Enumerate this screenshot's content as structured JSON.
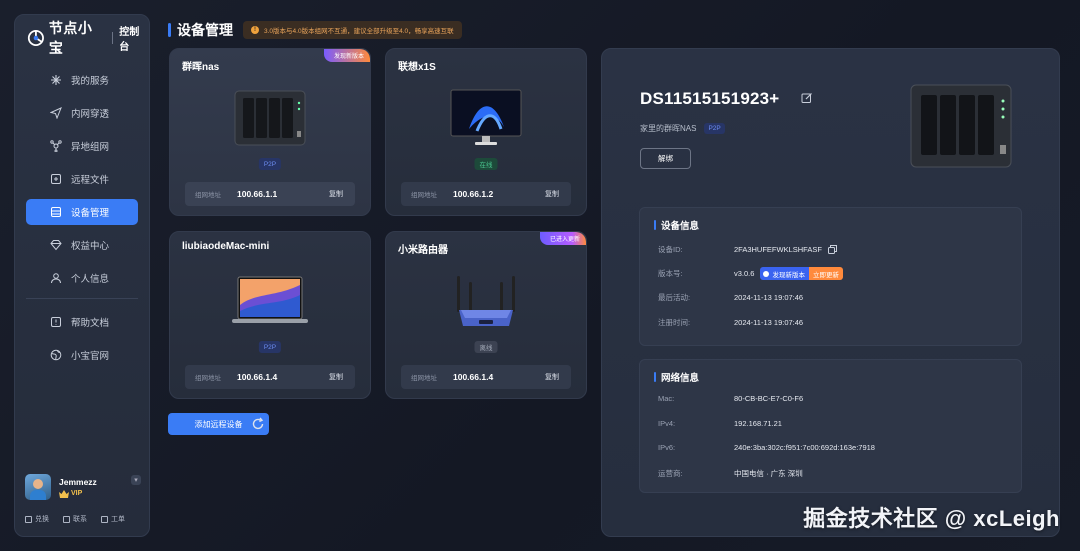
{
  "brand": {
    "name": "节点小宝",
    "sub": "控制台"
  },
  "sidebar": {
    "items": [
      {
        "label": "我的服务",
        "icon": "services-icon"
      },
      {
        "label": "内网穿透",
        "icon": "send-icon"
      },
      {
        "label": "异地组网",
        "icon": "network-icon"
      },
      {
        "label": "远程文件",
        "icon": "folder-icon"
      },
      {
        "label": "设备管理",
        "icon": "device-icon",
        "active": true
      },
      {
        "label": "权益中心",
        "icon": "diamond-icon"
      },
      {
        "label": "个人信息",
        "icon": "user-icon"
      },
      {
        "label": "帮助文档",
        "icon": "doc-icon"
      },
      {
        "label": "小宝官网",
        "icon": "globe-icon"
      }
    ]
  },
  "user": {
    "name": "Jemmezz",
    "vip": "VIP",
    "actions": [
      "兑换",
      "联系",
      "工单"
    ]
  },
  "header": {
    "title": "设备管理",
    "notice": "3.0版本与4.0版本组网不互通，建议全部升级至4.0，畅享高速互联"
  },
  "devices": [
    {
      "name": "群晖nas",
      "ribbon": "发现新版本",
      "status": "P2P",
      "addr_label": "组网地址",
      "addr": "100.66.1.1",
      "copy": "复制"
    },
    {
      "name": "联想x1S",
      "ribbon": "",
      "status": "在线",
      "addr_label": "组网地址",
      "addr": "100.66.1.2",
      "copy": "复制"
    },
    {
      "name": "liubiaodeMac-mini",
      "ribbon": "",
      "status": "P2P",
      "addr_label": "组网地址",
      "addr": "100.66.1.4",
      "copy": "复制"
    },
    {
      "name": "小米路由器",
      "ribbon": "已进入更新",
      "status": "离线",
      "addr_label": "组网地址",
      "addr": "100.66.1.4",
      "copy": "复制"
    }
  ],
  "actions": {
    "add_label": "添加远程设备"
  },
  "detail": {
    "name": "DS11515151923+",
    "desc": "家里的群晖NAS",
    "badge": "P2P",
    "unbind": "解绑",
    "device_info": {
      "title": "设备信息",
      "id_label": "设备ID:",
      "id": "2FA3HUFEFWKLSHFASF",
      "version_label": "版本号:",
      "version": "v3.0.6",
      "new_version": "发现新版本",
      "update_now": "立即更新",
      "last_active_label": "最后活动:",
      "last_active": "2024-11-13 19:07:46",
      "register_label": "注册时间:",
      "register": "2024-11-13 19:07:46"
    },
    "network_info": {
      "title": "网络信息",
      "mac_label": "Mac:",
      "mac": "80-CB-BC-E7-C0-F6",
      "ipv4_label": "IPv4:",
      "ipv4": "192.168.71.21",
      "ipv6_label": "IPv6:",
      "ipv6": "240e:3ba:302c:f951:7c00:692d:163e:7918",
      "isp_label": "运营商:",
      "isp": "中国电信 · 广东 深圳"
    }
  },
  "watermark": "掘金技术社区 @ xcLeigh",
  "colors": {
    "accent": "#3a7cf5",
    "warning": "#f0a23c",
    "online": "#49c48e",
    "ribbon": "#ff8a3c"
  }
}
